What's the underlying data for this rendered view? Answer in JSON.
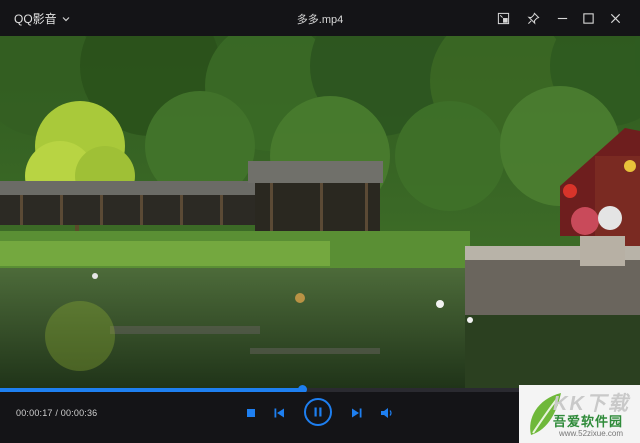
{
  "app": {
    "menu_label": "QQ影音"
  },
  "file": {
    "title": "多多.mp4"
  },
  "titlebar": {
    "buttons": [
      {
        "name": "pip-icon"
      },
      {
        "name": "pin-icon"
      },
      {
        "name": "minimize-icon"
      },
      {
        "name": "maximize-icon"
      },
      {
        "name": "close-icon"
      }
    ]
  },
  "playback": {
    "current_time": "00:00:17",
    "separator": " / ",
    "duration": "00:00:36",
    "time_text": "00:00:17 / 00:00:36",
    "progress_fraction": 0.472,
    "state": "playing"
  },
  "controls": {
    "stop": "stop-icon",
    "previous": "previous-icon",
    "play_pause": "pause-icon",
    "next": "next-icon",
    "volume": "volume-icon"
  },
  "colors": {
    "accent": "#1e7ff0",
    "titlebar_bg": "#141417",
    "controls_bg": "#141417"
  },
  "watermark": {
    "big_text": "KK下载",
    "name": "吾爱软件园",
    "url": "www.52zixue.com"
  }
}
